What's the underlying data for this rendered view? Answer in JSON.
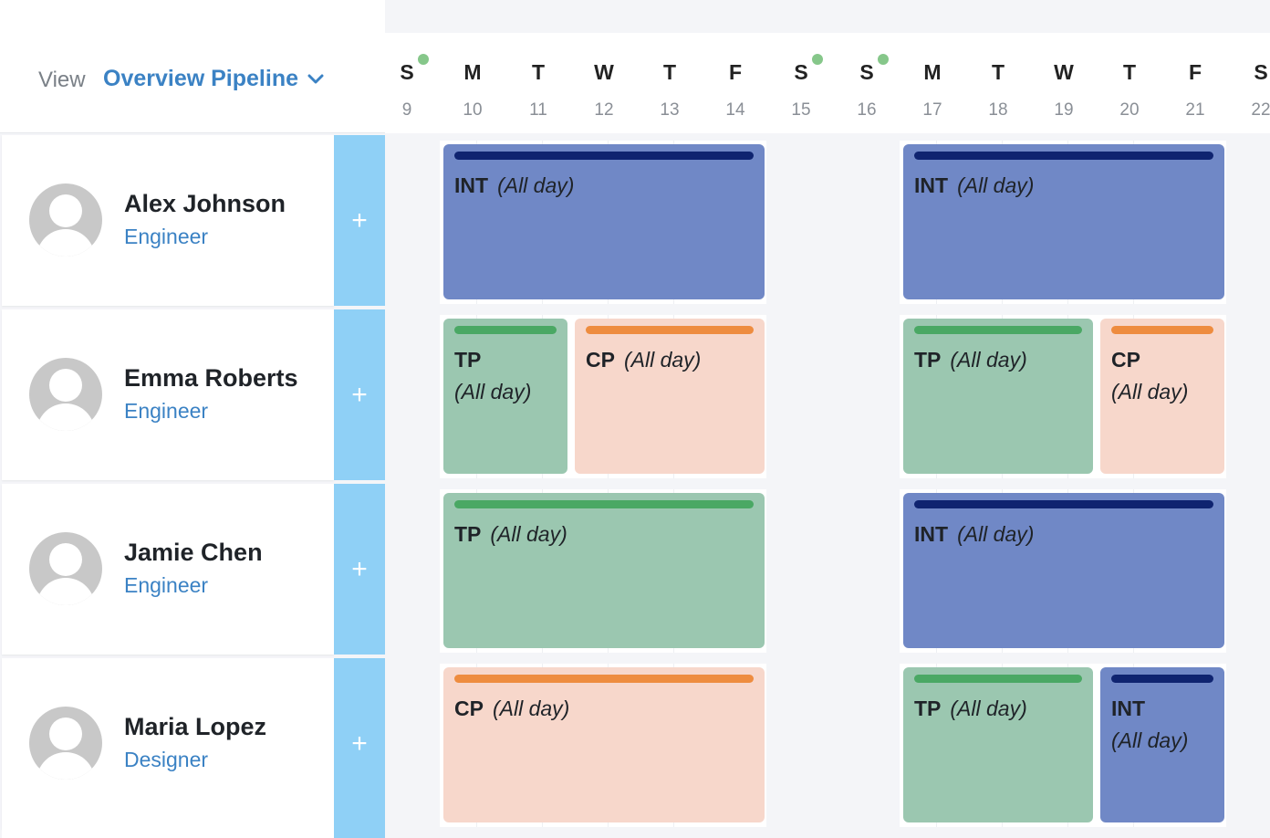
{
  "view": {
    "label": "View",
    "selected": "Overview Pipeline"
  },
  "days": [
    {
      "wd": "S",
      "dn": "9",
      "dot": true
    },
    {
      "wd": "M",
      "dn": "10",
      "dot": false
    },
    {
      "wd": "T",
      "dn": "11",
      "dot": false
    },
    {
      "wd": "W",
      "dn": "12",
      "dot": false
    },
    {
      "wd": "T",
      "dn": "13",
      "dot": false
    },
    {
      "wd": "F",
      "dn": "14",
      "dot": false
    },
    {
      "wd": "S",
      "dn": "15",
      "dot": true
    },
    {
      "wd": "S",
      "dn": "16",
      "dot": true
    },
    {
      "wd": "M",
      "dn": "17",
      "dot": false
    },
    {
      "wd": "T",
      "dn": "18",
      "dot": false
    },
    {
      "wd": "W",
      "dn": "19",
      "dot": false
    },
    {
      "wd": "T",
      "dn": "20",
      "dot": false
    },
    {
      "wd": "F",
      "dn": "21",
      "dot": false
    },
    {
      "wd": "S",
      "dn": "22",
      "dot": false
    }
  ],
  "add_label": "+",
  "all_day_label": "(All day)",
  "people": [
    {
      "name": "Alex Johnson",
      "role": "Engineer"
    },
    {
      "name": "Emma Roberts",
      "role": "Engineer"
    },
    {
      "name": "Jamie Chen",
      "role": "Engineer"
    },
    {
      "name": "Maria Lopez",
      "role": "Designer"
    }
  ],
  "event_types": {
    "INT": {
      "bg": "#7088c6",
      "bar": "#0f2470"
    },
    "TP": {
      "bg": "#9bc7b0",
      "bar": "#4aa864"
    },
    "CP": {
      "bg": "#f7d7cb",
      "bar": "#ee8c3f"
    }
  },
  "events": [
    {
      "row": 0,
      "week": 0,
      "code": "INT",
      "start": 0,
      "span": 5
    },
    {
      "row": 0,
      "week": 1,
      "code": "INT",
      "start": 0,
      "span": 5
    },
    {
      "row": 1,
      "week": 0,
      "code": "TP",
      "start": 0,
      "span": 2
    },
    {
      "row": 1,
      "week": 0,
      "code": "CP",
      "start": 2,
      "span": 3
    },
    {
      "row": 1,
      "week": 1,
      "code": "TP",
      "start": 0,
      "span": 3
    },
    {
      "row": 1,
      "week": 1,
      "code": "CP",
      "start": 3,
      "span": 2
    },
    {
      "row": 2,
      "week": 0,
      "code": "TP",
      "start": 0,
      "span": 5
    },
    {
      "row": 2,
      "week": 1,
      "code": "INT",
      "start": 0,
      "span": 5
    },
    {
      "row": 3,
      "week": 0,
      "code": "CP",
      "start": 0,
      "span": 5
    },
    {
      "row": 3,
      "week": 1,
      "code": "TP",
      "start": 0,
      "span": 3
    },
    {
      "row": 3,
      "week": 1,
      "code": "INT",
      "start": 3,
      "span": 2
    }
  ]
}
